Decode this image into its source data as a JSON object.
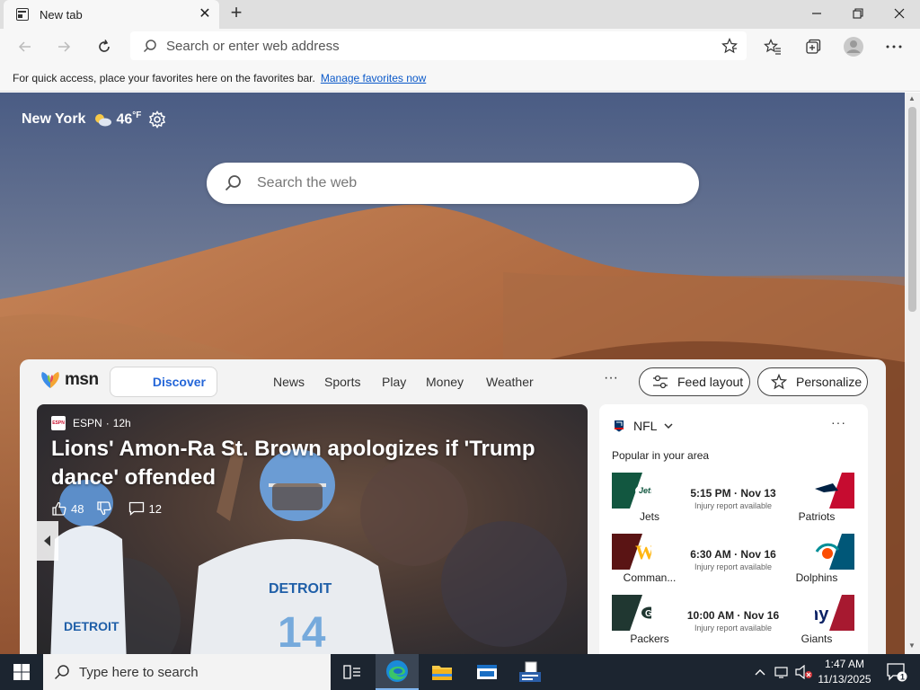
{
  "browser": {
    "tab_title": "New tab",
    "address_placeholder": "Search or enter web address",
    "favbar_text": "For quick access, place your favorites here on the favorites bar.",
    "favbar_link": "Manage favorites now"
  },
  "newtab": {
    "weather": {
      "location": "New York",
      "temp": "46",
      "unit": "°F"
    },
    "search_placeholder": "Search the web",
    "brand": "msn",
    "nav": {
      "discover": "Discover",
      "links": [
        "News",
        "Sports",
        "Play",
        "Money",
        "Weather"
      ],
      "feed_layout": "Feed layout",
      "personalize": "Personalize"
    },
    "hero": {
      "source": "ESPN",
      "age": "12h",
      "headline": "Lions' Amon-Ra St. Brown apologizes if 'Trump dance' offended",
      "likes": "48",
      "comments": "12"
    },
    "sports": {
      "league": "NFL",
      "popular_label": "Popular in your area",
      "games": [
        {
          "time": "5:15 PM · Nov 13",
          "note": "Injury report available",
          "away": "Jets",
          "home": "Patriots",
          "away_color": "#125740",
          "home_color": "#002244",
          "home_accent": "#c60c30"
        },
        {
          "time": "6:30 AM · Nov 16",
          "note": "Injury report available",
          "away": "Comman...",
          "home": "Dolphins",
          "away_color": "#5a1414",
          "home_color": "#008e97",
          "home_accent": "#005778"
        },
        {
          "time": "10:00 AM · Nov 16",
          "note": "Injury report available",
          "away": "Packers",
          "home": "Giants",
          "away_color": "#203731",
          "home_color": "#0b2265",
          "home_accent": "#a71930"
        }
      ]
    }
  },
  "taskbar": {
    "search_placeholder": "Type here to search",
    "time": "1:47 AM",
    "date": "11/13/2025",
    "notification_count": "1"
  }
}
